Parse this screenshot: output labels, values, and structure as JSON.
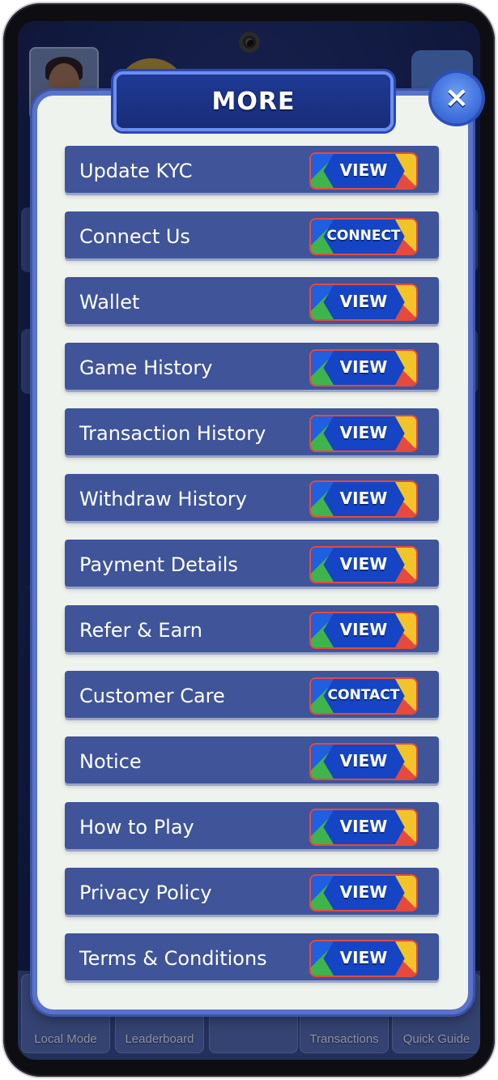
{
  "modal": {
    "title": "MORE",
    "close_symbol": "×",
    "items": [
      {
        "label": "Update KYC",
        "button": "VIEW"
      },
      {
        "label": "Connect Us",
        "button": "CONNECT"
      },
      {
        "label": "Wallet",
        "button": "VIEW"
      },
      {
        "label": "Game History",
        "button": "VIEW"
      },
      {
        "label": "Transaction History",
        "button": "VIEW"
      },
      {
        "label": "Withdraw History",
        "button": "VIEW"
      },
      {
        "label": "Payment Details",
        "button": "VIEW"
      },
      {
        "label": "Refer & Earn",
        "button": "VIEW"
      },
      {
        "label": "Customer Care",
        "button": "CONTACT"
      },
      {
        "label": "Notice",
        "button": "VIEW"
      },
      {
        "label": "How to Play",
        "button": "VIEW"
      },
      {
        "label": "Privacy Policy",
        "button": "VIEW"
      },
      {
        "label": "Terms & Conditions",
        "button": "VIEW"
      }
    ]
  },
  "bottom_nav": {
    "items": [
      "Local Mode",
      "Leaderboard",
      "",
      "Transactions",
      "Quick Guide"
    ]
  },
  "colors": {
    "row_bg": "#3f5499",
    "modal_bg": "#eef3ee",
    "header_bg": "#1f3a95",
    "button_bg": "#1545c4"
  }
}
